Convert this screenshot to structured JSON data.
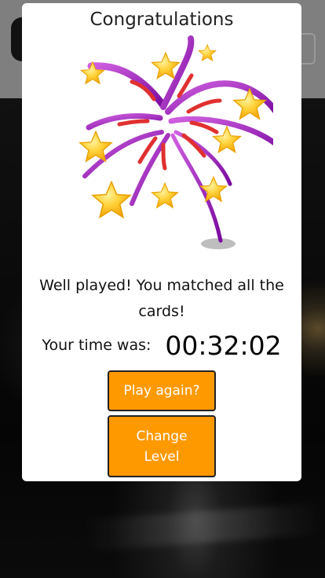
{
  "modal": {
    "title": "Congratulations",
    "message": "Well played! You matched all the cards!",
    "time_label": "Your time was:",
    "time_value": "00:32:02",
    "play_again_label": "Play again?",
    "change_level_label": "Change Level"
  },
  "colors": {
    "button_bg": "#ff9900",
    "firework_purple": "#a020c0",
    "firework_red": "#e03030",
    "star": "#ffc820"
  },
  "icons": {
    "illustration": "fireworks-icon",
    "menu": "hamburger-menu-icon",
    "logo": "logo-icon"
  }
}
